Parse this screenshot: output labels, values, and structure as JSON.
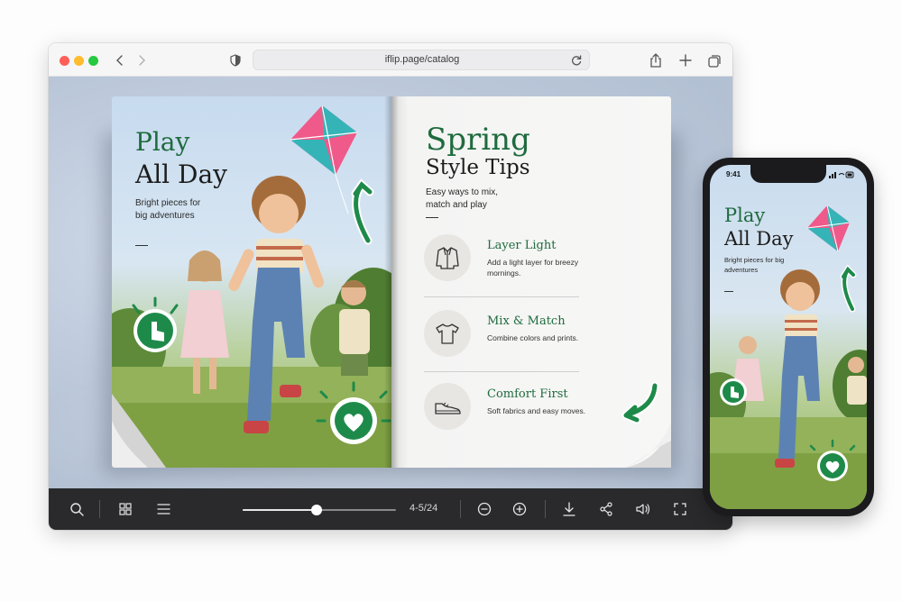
{
  "browser": {
    "url": "iflip.page/catalog"
  },
  "left_page": {
    "title_line1": "Play",
    "title_line2": "All Day",
    "subtitle": "Bright pieces for big adventures"
  },
  "right_page": {
    "title_line1": "Spring",
    "title_line2": "Style Tips",
    "subtitle": "Easy ways to mix, match and play",
    "tips": [
      {
        "title": "Layer Light",
        "desc": "Add a light layer for breezy mornings.",
        "icon": "jacket-icon"
      },
      {
        "title": "Mix & Match",
        "desc": "Combine colors and prints.",
        "icon": "tshirt-icon"
      },
      {
        "title": "Comfort First",
        "desc": "Soft fabrics and easy moves.",
        "icon": "sneaker-icon"
      }
    ]
  },
  "toolbar": {
    "page_indicator": "4-5/24",
    "progress": 0.48
  },
  "phone": {
    "time": "9:41",
    "title_line1": "Play",
    "title_line2": "All Day",
    "subtitle": "Bright pieces for big adventures"
  },
  "colors": {
    "accent_green": "#1f6b3e",
    "sticker_green": "#1e8a4a",
    "toolbar_bg": "#2a2a2c",
    "kite_pink": "#ef5a8a",
    "kite_teal": "#35b4b8"
  }
}
